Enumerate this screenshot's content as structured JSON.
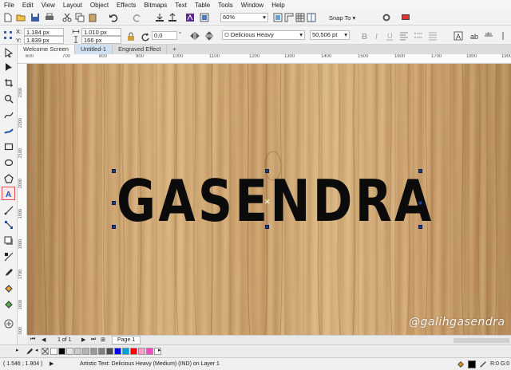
{
  "menu": [
    "File",
    "Edit",
    "View",
    "Layout",
    "Object",
    "Effects",
    "Bitmaps",
    "Text",
    "Table",
    "Tools",
    "Window",
    "Help"
  ],
  "toolbar": {
    "zoom_value": "60%",
    "snap_label": "Snap To"
  },
  "property_bar": {
    "x_value": "1.184 px",
    "y_value": "1.839 px",
    "width_value": "1.010 px",
    "height_value": "166 px",
    "rotation_value": "0,0",
    "font_name": "Delicious Heavy",
    "font_size": "50,506 pt",
    "x_label": "X:",
    "y_label": "Y:",
    "degree_symbol": "°"
  },
  "tabs": [
    "Welcome Screen",
    "Untitled-1",
    "Engraved Effect"
  ],
  "ruler": {
    "h_ticks": [
      "600",
      "700",
      "800",
      "900",
      "1000",
      "1100",
      "1200",
      "1300",
      "1400",
      "1500",
      "1600",
      "1700",
      "1800",
      "1900"
    ],
    "v_ticks": [
      "2300",
      "2200",
      "2100",
      "2000",
      "1900",
      "1800",
      "1700",
      "1600",
      "1500"
    ]
  },
  "document": {
    "main_text": "GASENDRA",
    "watermark": "@galihgasendra"
  },
  "page_nav": {
    "page_count": "1 of 1",
    "page_tab": "Page 1"
  },
  "palette": {
    "colors": [
      "#ffffff",
      "#000000",
      "#e6e6e6",
      "#cccccc",
      "#b3b3b3",
      "#999999",
      "#808080",
      "#4d4d4d",
      "#0000ff",
      "#00a0e9",
      "#ff0000",
      "#ffa0c8",
      "#f04ec0",
      "#ffffff"
    ]
  },
  "status": {
    "coords": "( 1.546 ; 1.904 )",
    "message": "Artistic Text: Delicious Heavy (Medium) (IND) on Layer 1",
    "fill_readout": "R:0 G:0"
  }
}
